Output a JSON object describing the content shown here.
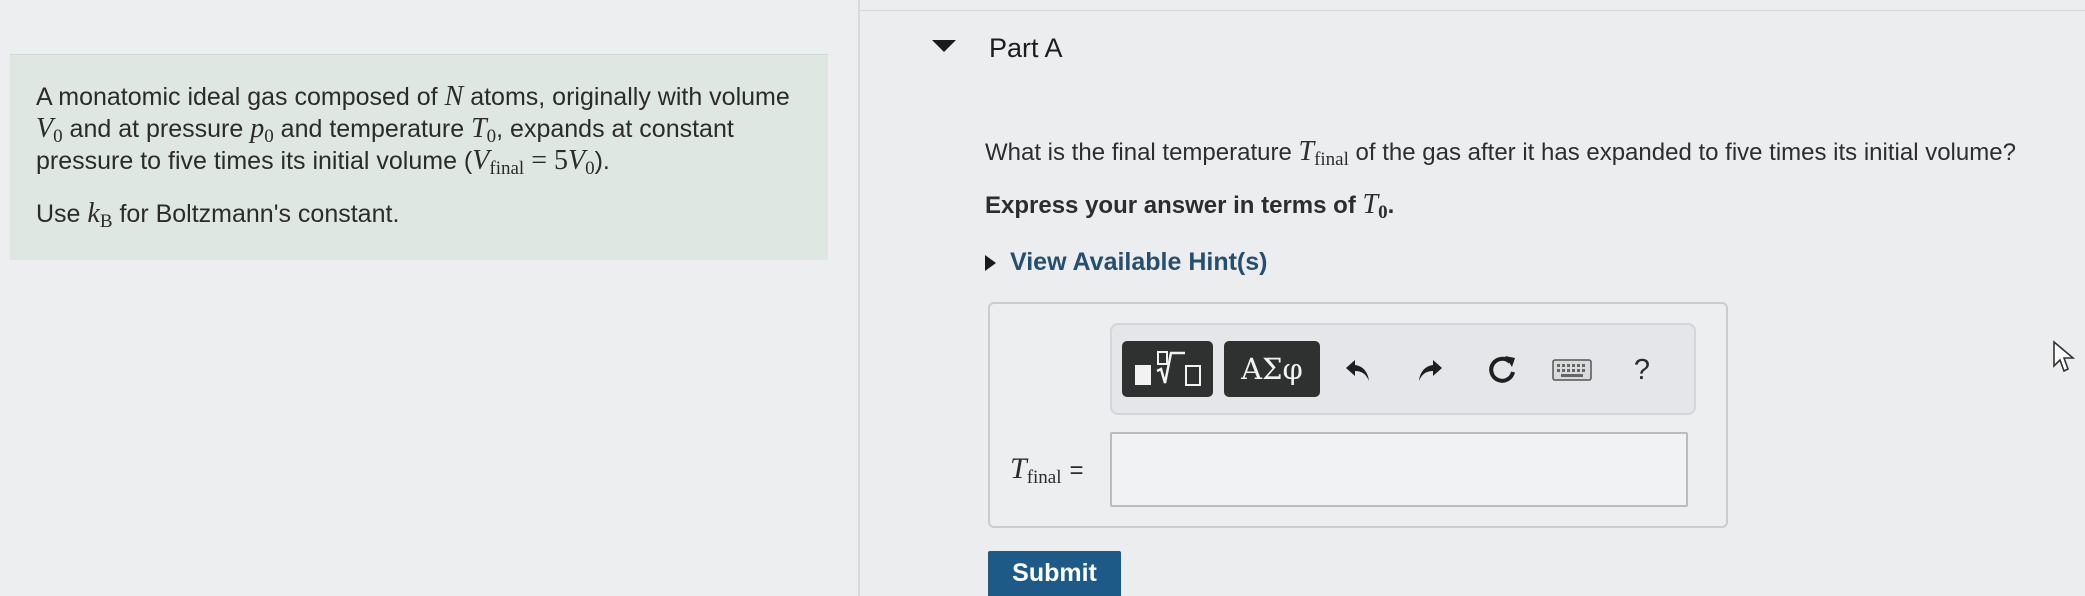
{
  "problem": {
    "p1_a": "A monatomic ideal gas composed of ",
    "N": "N",
    "p1_b": " atoms, originally with volume ",
    "V": "V",
    "zero": "0",
    "p1_c": " and at pressure ",
    "p": "p",
    "p1_d": " and temperature ",
    "T": "T",
    "p1_e": ", expands at constant pressure to five times its initial volume (",
    "final": "final",
    "eq5": " = 5",
    "p1_f": ").",
    "p2_a": "Use ",
    "k": "k",
    "B": "B",
    "p2_b": " for Boltzmann's constant."
  },
  "part": {
    "title": "Part A",
    "q_a": "What is the final temperature ",
    "q_b": " of the gas after it has expanded to five times its initial volume?",
    "instr_a": "Express your answer in terms of ",
    "instr_b": ".",
    "hint_label": "View Available Hint(s)"
  },
  "toolbar": {
    "greek_label": "ΑΣφ",
    "help_label": "?",
    "icons": [
      "templates-icon",
      "greek-symbols-icon",
      "undo-icon",
      "redo-icon",
      "reset-icon",
      "keyboard-icon",
      "help-icon"
    ]
  },
  "answer": {
    "eq": "=",
    "value": ""
  },
  "submit_label": "Submit",
  "colors": {
    "problem_bg": "#dfe7e2",
    "hint_link": "#24506e",
    "submit_bg": "#1d5a88",
    "toolbar_btn": "#2f3131"
  }
}
